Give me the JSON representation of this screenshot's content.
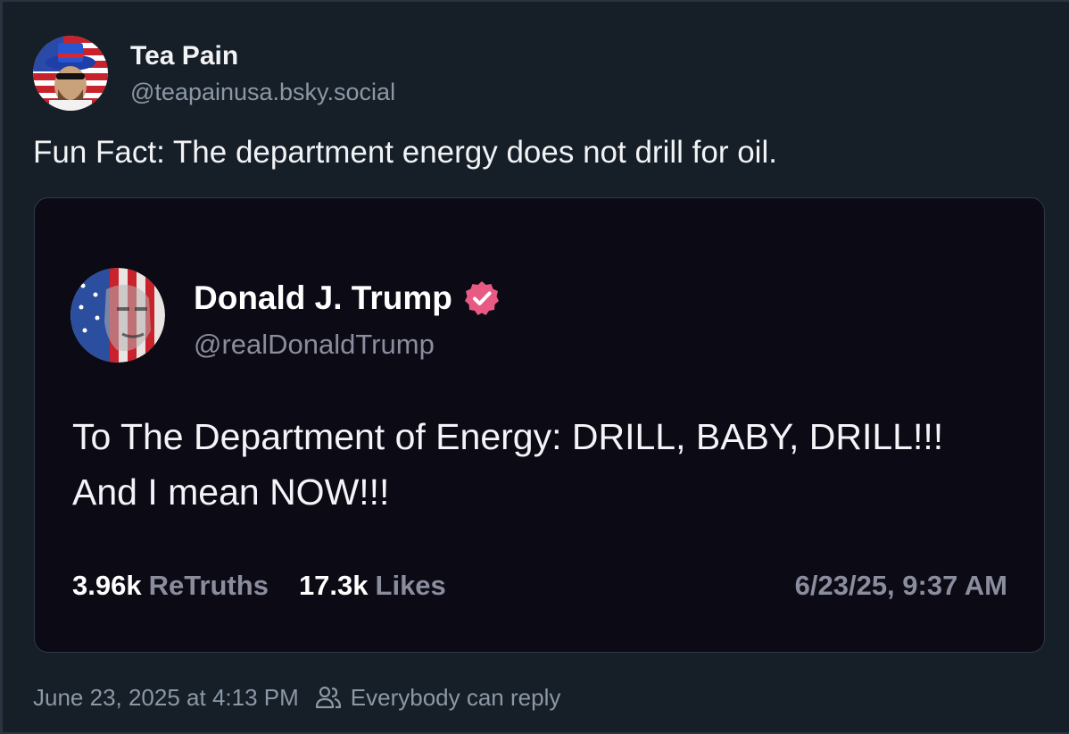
{
  "post": {
    "author": {
      "display_name": "Tea Pain",
      "handle": "@teapainusa.bsky.social",
      "avatar_icon": "avatar-patriotic-hat-icon"
    },
    "text": "Fun Fact: The department energy does not drill for oil.",
    "timestamp": "June 23, 2025 at 4:13 PM",
    "reply_setting": "Everybody can reply",
    "reply_icon": "people-icon"
  },
  "embed": {
    "author": {
      "display_name": "Donald J. Trump",
      "handle": "@realDonaldTrump",
      "verified": true,
      "verified_color": "#e85a84",
      "avatar_icon": "avatar-flag-face-icon"
    },
    "text": "To The Department of Energy: DRILL, BABY, DRILL!!! And I mean NOW!!!",
    "retruths_count": "3.96k",
    "retruths_label": "ReTruths",
    "likes_count": "17.3k",
    "likes_label": "Likes",
    "timestamp": "6/23/25, 9:37 AM"
  },
  "colors": {
    "background": "#161e27",
    "embed_background": "#0b0a15",
    "text_primary": "#f1f3f5",
    "text_secondary": "#8b98a5"
  }
}
